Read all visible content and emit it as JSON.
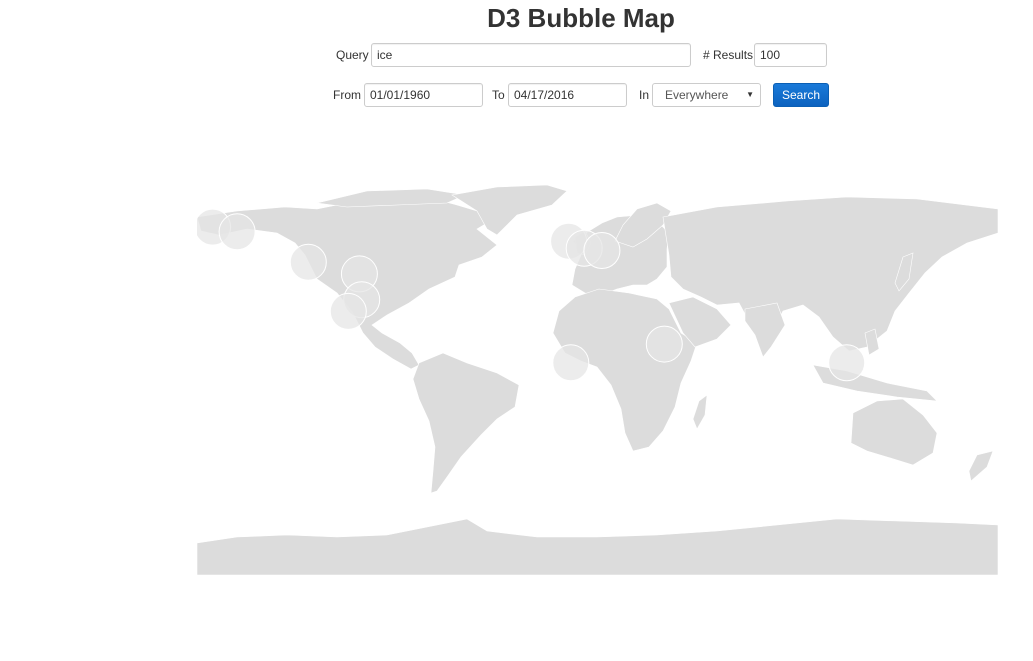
{
  "page": {
    "title": "D3 Bubble Map"
  },
  "search_form": {
    "query_label": "Query",
    "query_value": "ice",
    "results_label": "# Results",
    "results_value": "100",
    "from_label": "From",
    "from_value": "01/01/1960",
    "to_label": "To",
    "to_value": "04/17/2016",
    "in_label": "In",
    "in_selected": "Everywhere",
    "search_button": "Search"
  },
  "map": {
    "projection": "equirectangular",
    "land_color": "#dcdcdc",
    "border_color": "#ffffff",
    "bubble_color": "#e6e6e6",
    "bubbles": [
      {
        "lon": -163,
        "lat": 65
      },
      {
        "lon": -152,
        "lat": 63
      },
      {
        "lon": -120,
        "lat": 50
      },
      {
        "lon": -97,
        "lat": 45
      },
      {
        "lon": -96,
        "lat": 34
      },
      {
        "lon": -102,
        "lat": 29
      },
      {
        "lon": -3,
        "lat": 59
      },
      {
        "lon": 4,
        "lat": 56
      },
      {
        "lon": 12,
        "lat": 55
      },
      {
        "lon": 40,
        "lat": 15
      },
      {
        "lon": -2,
        "lat": 7
      },
      {
        "lon": 122,
        "lat": 7
      }
    ]
  }
}
